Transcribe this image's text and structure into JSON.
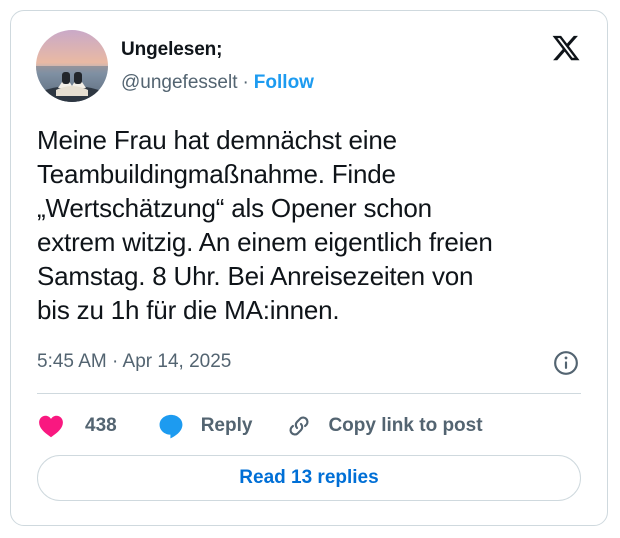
{
  "author": {
    "display_name": "Ungelesen;",
    "handle": "@ungefesselt",
    "separator": "·",
    "follow_label": "Follow",
    "avatar_icon": "avatar-reading-by-lake"
  },
  "brand": {
    "logo_icon": "x-logo-icon"
  },
  "tweet": {
    "text": "Meine Frau hat demnächst eine\nTeambuildingmaßnahme. Finde\n„Wertschätzung“ als Opener schon\nextrem witzig. An einem eigentlich freien\nSamstag. 8 Uhr. Bei Anreisezeiten von\nbis zu 1h für die MA:innen.",
    "timestamp": "5:45 AM · Apr 14, 2025"
  },
  "actions": {
    "like_count": "438",
    "reply_label": "Reply",
    "copy_link_label": "Copy link to post"
  },
  "replies": {
    "button_label": "Read 13 replies"
  },
  "colors": {
    "like": "#f91880",
    "reply": "#1d9bf0",
    "link": "#006fd6",
    "muted": "#536471",
    "border": "#cfd9de"
  }
}
